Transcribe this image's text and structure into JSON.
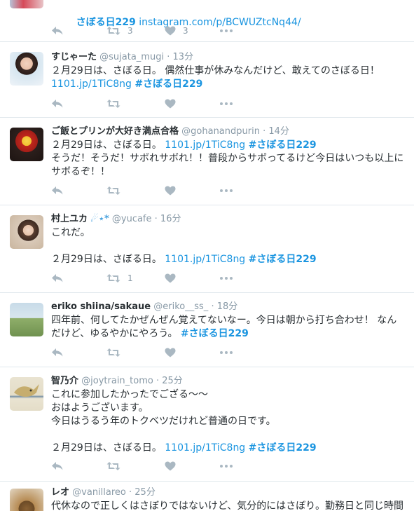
{
  "tweets": [
    {
      "lines": [
        {
          "segments": [
            {
              "type": "hashtag",
              "text": "さぼる日229"
            },
            {
              "type": "text",
              "text": " "
            },
            {
              "type": "link",
              "text": "instagram.com/p/BCWUZtcNq44/"
            }
          ]
        }
      ],
      "retweets": "3",
      "likes": "3"
    },
    {
      "name": "すじゃーた",
      "handle": "@sujata_mugi",
      "time": "· 13分",
      "lines": [
        {
          "segments": [
            {
              "type": "text",
              "text": "２月29日は、さぼる日。 偶然仕事が休みなんだけど、敢えてのさぼる日！"
            }
          ]
        },
        {
          "segments": [
            {
              "type": "link",
              "text": "1101.jp/1TiC8ng"
            },
            {
              "type": "text",
              "text": " "
            },
            {
              "type": "hashtag",
              "text": "#さぼる日229"
            }
          ]
        }
      ],
      "retweets": "",
      "likes": ""
    },
    {
      "name": "ご飯とプリンが大好き満点合格",
      "handle": "@gohanandpurin",
      "time": "· 14分",
      "lines": [
        {
          "segments": [
            {
              "type": "text",
              "text": "２月29日は、さぼる日。 "
            },
            {
              "type": "link",
              "text": "1101.jp/1TiC8ng"
            },
            {
              "type": "text",
              "text": " "
            },
            {
              "type": "hashtag",
              "text": "#さぼる日229"
            }
          ]
        },
        {
          "segments": [
            {
              "type": "text",
              "text": "そうだ！そうだ！サボれサボれ！！普段からサボってるけど今日はいつも以上に"
            }
          ]
        },
        {
          "segments": [
            {
              "type": "text",
              "text": "サボるぞ！！"
            }
          ]
        }
      ],
      "retweets": "",
      "likes": ""
    },
    {
      "name": "村上ユカ",
      "name_suffix": "☄⋆*",
      "handle": "@yucafe",
      "time": "· 16分",
      "lines": [
        {
          "segments": [
            {
              "type": "text",
              "text": "これだ。"
            }
          ]
        },
        {
          "segments": [
            {
              "type": "text",
              "text": " "
            }
          ]
        },
        {
          "segments": [
            {
              "type": "text",
              "text": "２月29日は、さぼる日。 "
            },
            {
              "type": "link",
              "text": "1101.jp/1TiC8ng"
            },
            {
              "type": "text",
              "text": " "
            },
            {
              "type": "hashtag",
              "text": "#さぼる日229"
            }
          ]
        }
      ],
      "retweets": "1",
      "likes": ""
    },
    {
      "name": "eriko shiina/sakaue",
      "handle": "@eriko__ss_",
      "time": "· 18分",
      "lines": [
        {
          "segments": [
            {
              "type": "text",
              "text": "四年前、何してたかぜんぜん覚えてないなー。今日は朝から打ち合わせ！ なん"
            }
          ]
        },
        {
          "segments": [
            {
              "type": "text",
              "text": "だけど、ゆるやかにやろう。 "
            },
            {
              "type": "hashtag",
              "text": "#さぼる日229"
            }
          ]
        }
      ],
      "retweets": "",
      "likes": ""
    },
    {
      "name": "智乃介",
      "handle": "@joytrain_tomo",
      "time": "· 25分",
      "lines": [
        {
          "segments": [
            {
              "type": "text",
              "text": "これに参加したかったでござる〜〜"
            }
          ]
        },
        {
          "segments": [
            {
              "type": "text",
              "text": "おはようございます。"
            }
          ]
        },
        {
          "segments": [
            {
              "type": "text",
              "text": "今日はうるう年のトクベツだけれど普通の日です。"
            }
          ]
        },
        {
          "segments": [
            {
              "type": "text",
              "text": " "
            }
          ]
        },
        {
          "segments": [
            {
              "type": "text",
              "text": "２月29日は、さぼる日。 "
            },
            {
              "type": "link",
              "text": "1101.jp/1TiC8ng"
            },
            {
              "type": "text",
              "text": " "
            },
            {
              "type": "hashtag",
              "text": "#さぼる日229"
            }
          ]
        }
      ],
      "retweets": "",
      "likes": ""
    },
    {
      "name": "レオ",
      "handle": "@vanillareo",
      "time": "· 25分",
      "lines": [
        {
          "segments": [
            {
              "type": "text",
              "text": "代休なので正しくはさぼりではないけど、気分的にはさぼり。勤務日と同じ時間"
            }
          ]
        }
      ],
      "retweets": "",
      "likes": ""
    }
  ],
  "colors": {
    "link": "#1b95e0",
    "icon": "#aab8c2",
    "meta": "#8899a6",
    "border": "#e1e8ed"
  }
}
